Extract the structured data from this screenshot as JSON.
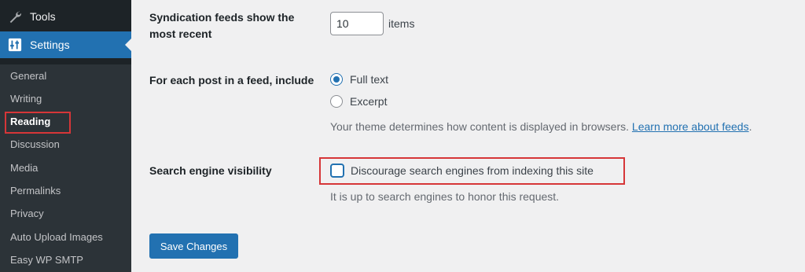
{
  "sidebar": {
    "tools_label": "Tools",
    "settings_label": "Settings",
    "submenu": [
      {
        "label": "General"
      },
      {
        "label": "Writing"
      },
      {
        "label": "Reading",
        "current": true
      },
      {
        "label": "Discussion"
      },
      {
        "label": "Media"
      },
      {
        "label": "Permalinks"
      },
      {
        "label": "Privacy"
      },
      {
        "label": "Auto Upload Images"
      },
      {
        "label": "Easy WP SMTP"
      }
    ]
  },
  "settings": {
    "syndication_label": "Syndication feeds show the most recent",
    "syndication_value": "10",
    "syndication_unit": "items",
    "feed_include_label": "For each post in a feed, include",
    "feed_options": [
      {
        "label": "Full text",
        "checked": true
      },
      {
        "label": "Excerpt",
        "checked": false
      }
    ],
    "feed_description": "Your theme determines how content is displayed in browsers.",
    "feed_link": "Learn more about feeds",
    "feed_desc_end": ".",
    "visibility_label": "Search engine visibility",
    "visibility_checkbox_label": "Discourage search engines from indexing this site",
    "visibility_checked": false,
    "visibility_description": "It is up to search engines to honor this request.",
    "save_button": "Save Changes"
  },
  "colors": {
    "sidebar_bg": "#1d2327",
    "accent": "#2271b1",
    "highlight": "#d63638"
  }
}
